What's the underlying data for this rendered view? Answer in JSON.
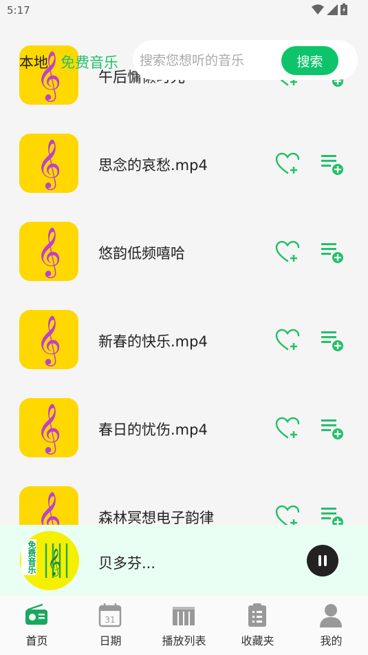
{
  "status_bar": {
    "time": "5:17"
  },
  "header": {
    "tab_local": "本地",
    "tab_free_music": "免费音乐",
    "search_placeholder": "搜索您想听的音乐",
    "search_button": "搜索"
  },
  "songs": [
    {
      "title": "午后慵懒时光"
    },
    {
      "title": "思念的哀愁.mp4"
    },
    {
      "title": "悠韵低频嘻哈"
    },
    {
      "title": "新春的快乐.mp4"
    },
    {
      "title": "春日的忧伤.mp4"
    },
    {
      "title": "森林冥想电子韵律"
    }
  ],
  "player": {
    "title": "贝多芬...",
    "cover_text": "免费音乐"
  },
  "nav": {
    "items": [
      {
        "label": "首页"
      },
      {
        "label": "日期"
      },
      {
        "label": "播放列表"
      },
      {
        "label": "收藏夹"
      },
      {
        "label": "我的"
      }
    ]
  },
  "colors": {
    "accent": "#0ec46a",
    "thumb_bg": "#ffd800",
    "player_bg": "#eafff4"
  }
}
